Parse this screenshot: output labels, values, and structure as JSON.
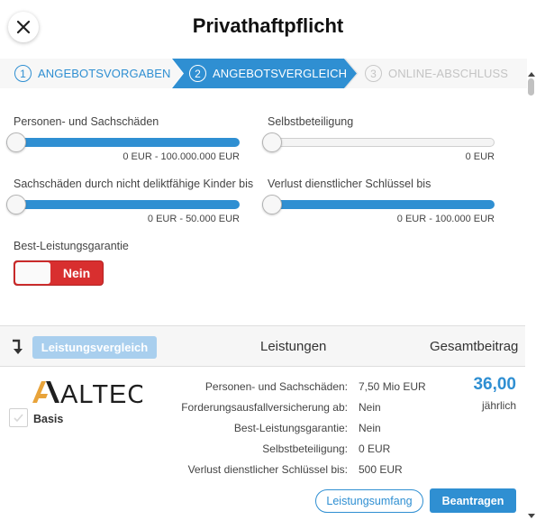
{
  "header": {
    "title": "Privathaftpflicht",
    "close_icon": "close-icon"
  },
  "stepper": {
    "steps": [
      {
        "number": "1",
        "label": "ANGEBOTSVORGABEN",
        "state": "done"
      },
      {
        "number": "2",
        "label": "ANGEBOTSVERGLEICH",
        "state": "active"
      },
      {
        "number": "3",
        "label": "ONLINE-ABSCHLUSS",
        "state": "upcoming"
      }
    ]
  },
  "filters": {
    "personen_sachschaeden": {
      "label": "Personen- und Sachschäden",
      "range": "0 EUR - 100.000.000 EUR",
      "level": 0
    },
    "selbstbeteiligung": {
      "label": "Selbstbeteiligung",
      "range": "0 EUR",
      "level": 0
    },
    "kinder": {
      "label": "Sachschäden durch nicht deliktfähige Kinder bis",
      "range": "0 EUR - 50.000 EUR",
      "level": 0
    },
    "schluessel": {
      "label": "Verlust dienstlicher Schlüssel bis",
      "range": "0 EUR - 100.000 EUR",
      "level": 0
    },
    "best_leistung": {
      "label": "Best-Leistungsgarantie",
      "toggle_value": "Nein"
    }
  },
  "results": {
    "compare_button": "Leistungsvergleich",
    "col_leistungen": "Leistungen",
    "col_gesamtbeitrag": "Gesamtbeitrag",
    "sort_icon": "sort-arrow-icon"
  },
  "offer": {
    "insurer_logo_text": "ALTEOS",
    "tariff": "Basis",
    "features": [
      {
        "label": "Personen- und Sachschäden:",
        "value": "7,50 Mio EUR"
      },
      {
        "label": "Forderungsausfallversicherung ab:",
        "value": "Nein"
      },
      {
        "label": "Best-Leistungsgarantie:",
        "value": "Nein"
      },
      {
        "label": "Selbstbeteiligung:",
        "value": "0 EUR"
      },
      {
        "label": "Verlust dienstlicher Schlüssel bis:",
        "value": "500 EUR"
      }
    ],
    "price": "36,00",
    "period": "jährlich",
    "btn_leistungsumfang": "Leistungsumfang",
    "btn_beantragen": "Beantragen"
  },
  "colors": {
    "accent": "#2f8fd2",
    "toggle_off": "#d82f2f",
    "compare_disabled": "#a9cfee"
  }
}
